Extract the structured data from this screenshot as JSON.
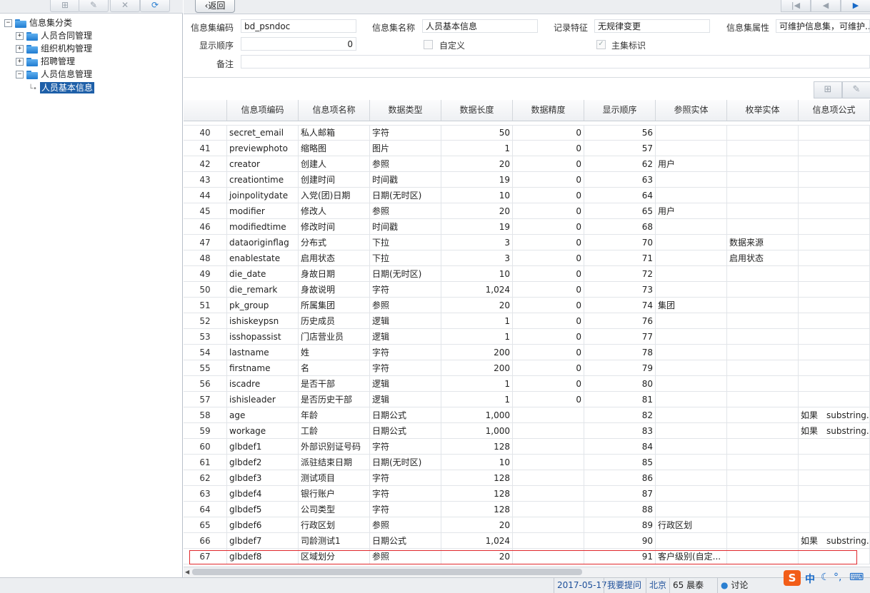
{
  "tree": {
    "root": "信息集分类",
    "items": [
      {
        "label": "人员合同管理",
        "expander": "+"
      },
      {
        "label": "组织机构管理",
        "expander": "+"
      },
      {
        "label": "招聘管理",
        "expander": "+"
      },
      {
        "label": "人员信息管理",
        "expander": "−"
      }
    ],
    "selected": "人员基本信息"
  },
  "toolbar": {
    "back_label": "返回"
  },
  "form": {
    "code_label": "信息集编码",
    "code_value": "bd_psndoc",
    "name_label": "信息集名称",
    "name_value": "人员基本信息",
    "record_label": "记录特征",
    "record_value": "无规律变更",
    "attr_label": "信息集属性",
    "attr_value": "可维护信息集，可维护...",
    "order_label": "显示顺序",
    "order_value": "0",
    "custom_label": "自定义",
    "main_label": "主集标识",
    "remark_label": "备注"
  },
  "grid": {
    "headers": [
      "信息项编码",
      "信息项名称",
      "数据类型",
      "数据长度",
      "数据精度",
      "显示顺序",
      "参照实体",
      "枚举实体",
      "信息项公式"
    ],
    "rows": [
      [
        "40",
        "secret_email",
        "私人邮箱",
        "字符",
        "50",
        "0",
        "56",
        "",
        "",
        ""
      ],
      [
        "41",
        "previewphoto",
        "缩略图",
        "图片",
        "1",
        "0",
        "57",
        "",
        "",
        ""
      ],
      [
        "42",
        "creator",
        "创建人",
        "参照",
        "20",
        "0",
        "62",
        "用户",
        "",
        ""
      ],
      [
        "43",
        "creationtime",
        "创建时间",
        "时间戳",
        "19",
        "0",
        "63",
        "",
        "",
        ""
      ],
      [
        "44",
        "joinpolitydate",
        "入党(团)日期",
        "日期(无时区)",
        "10",
        "0",
        "64",
        "",
        "",
        ""
      ],
      [
        "45",
        "modifier",
        "修改人",
        "参照",
        "20",
        "0",
        "65",
        "用户",
        "",
        ""
      ],
      [
        "46",
        "modifiedtime",
        "修改时间",
        "时间戳",
        "19",
        "0",
        "68",
        "",
        "",
        ""
      ],
      [
        "47",
        "dataoriginflag",
        "分布式",
        "下拉",
        "3",
        "0",
        "70",
        "",
        "数据来源",
        ""
      ],
      [
        "48",
        "enablestate",
        "启用状态",
        "下拉",
        "3",
        "0",
        "71",
        "",
        "启用状态",
        ""
      ],
      [
        "49",
        "die_date",
        "身故日期",
        "日期(无时区)",
        "10",
        "0",
        "72",
        "",
        "",
        ""
      ],
      [
        "50",
        "die_remark",
        "身故说明",
        "字符",
        "1,024",
        "0",
        "73",
        "",
        "",
        ""
      ],
      [
        "51",
        "pk_group",
        "所属集团",
        "参照",
        "20",
        "0",
        "74",
        "集团",
        "",
        ""
      ],
      [
        "52",
        "ishiskeypsn",
        "历史成员",
        "逻辑",
        "1",
        "0",
        "76",
        "",
        "",
        ""
      ],
      [
        "53",
        "isshopassist",
        "门店营业员",
        "逻辑",
        "1",
        "0",
        "77",
        "",
        "",
        ""
      ],
      [
        "54",
        "lastname",
        "姓",
        "字符",
        "200",
        "0",
        "78",
        "",
        "",
        ""
      ],
      [
        "55",
        "firstname",
        "名",
        "字符",
        "200",
        "0",
        "79",
        "",
        "",
        ""
      ],
      [
        "56",
        "iscadre",
        "是否干部",
        "逻辑",
        "1",
        "0",
        "80",
        "",
        "",
        ""
      ],
      [
        "57",
        "ishisleader",
        "是否历史干部",
        "逻辑",
        "1",
        "0",
        "81",
        "",
        "",
        ""
      ],
      [
        "58",
        "age",
        "年龄",
        "日期公式",
        "1,000",
        "",
        "82",
        "",
        "",
        "如果　substring..."
      ],
      [
        "59",
        "workage",
        "工龄",
        "日期公式",
        "1,000",
        "",
        "83",
        "",
        "",
        "如果　substring..."
      ],
      [
        "60",
        "glbdef1",
        "外部识别证号码",
        "字符",
        "128",
        "",
        "84",
        "",
        "",
        ""
      ],
      [
        "61",
        "glbdef2",
        "派驻结束日期",
        "日期(无时区)",
        "10",
        "",
        "85",
        "",
        "",
        ""
      ],
      [
        "62",
        "glbdef3",
        "测试项目",
        "字符",
        "128",
        "",
        "86",
        "",
        "",
        ""
      ],
      [
        "63",
        "glbdef4",
        "银行账户",
        "字符",
        "128",
        "",
        "87",
        "",
        "",
        ""
      ],
      [
        "64",
        "glbdef5",
        "公司类型",
        "字符",
        "128",
        "",
        "88",
        "",
        "",
        ""
      ],
      [
        "65",
        "glbdef6",
        "行政区划",
        "参照",
        "20",
        "",
        "89",
        "行政区划",
        "",
        ""
      ],
      [
        "66",
        "glbdef7",
        "司龄测试1",
        "日期公式",
        "1,024",
        "",
        "90",
        "",
        "",
        "如果　substring..."
      ],
      [
        "67",
        "glbdef8",
        "区域划分",
        "参照",
        "20",
        "",
        "91",
        "客户级别(自定...",
        "",
        ""
      ]
    ]
  },
  "status": {
    "date": "2017-05-17",
    "ask": "我要提问",
    "city": "北京",
    "weather": "65 晨泰",
    "discuss": "讨论"
  },
  "ime": {
    "logo": "S",
    "lang": "中"
  }
}
